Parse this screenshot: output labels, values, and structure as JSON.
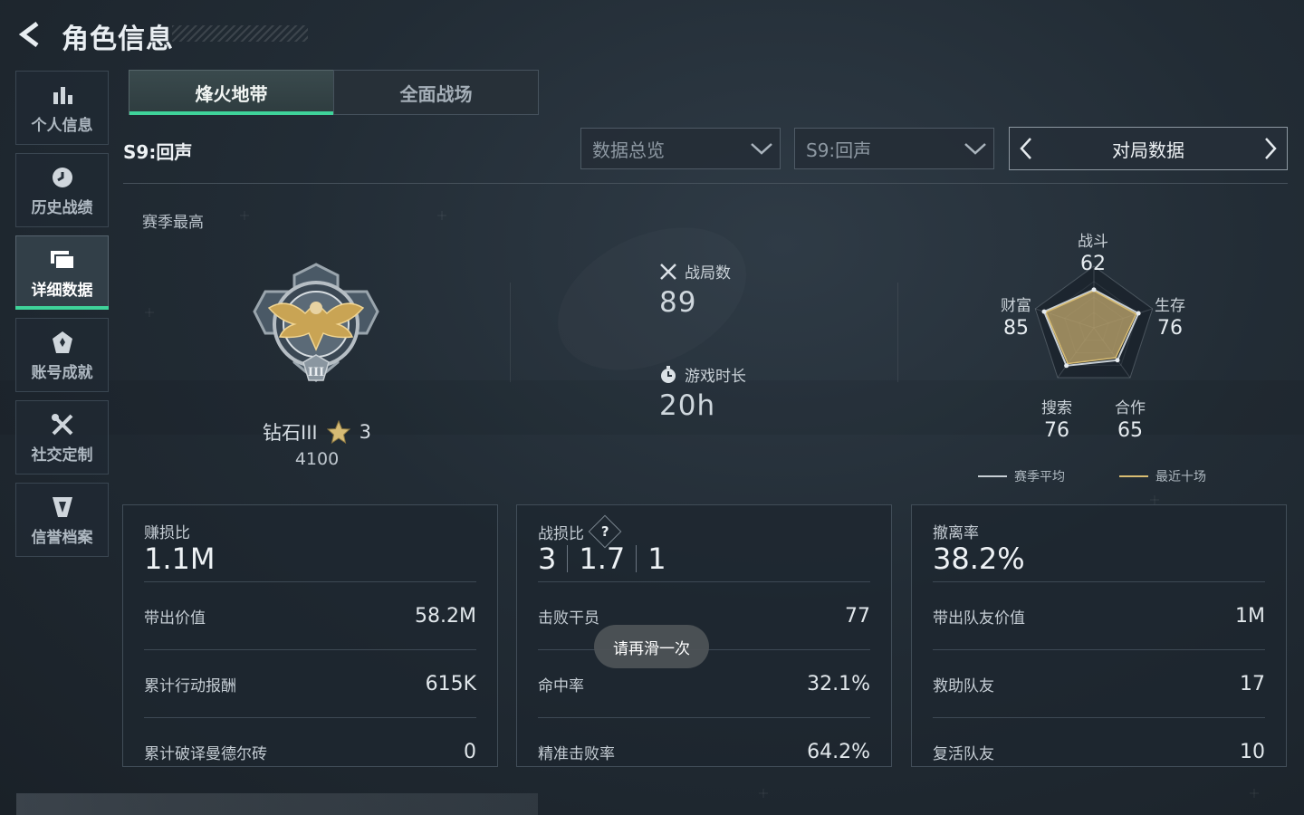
{
  "header": {
    "title": "角色信息"
  },
  "sidebar": {
    "items": [
      {
        "label": "个人信息",
        "icon": "bar-chart-icon"
      },
      {
        "label": "历史战绩",
        "icon": "clock-icon"
      },
      {
        "label": "详细数据",
        "icon": "cards-icon",
        "active": true
      },
      {
        "label": "账号成就",
        "icon": "achievement-icon"
      },
      {
        "label": "社交定制",
        "icon": "tools-icon"
      },
      {
        "label": "信誉档案",
        "icon": "shield-badge-icon"
      }
    ]
  },
  "tabs": [
    {
      "label": "烽火地带",
      "active": true
    },
    {
      "label": "全面战场",
      "active": false
    }
  ],
  "season_label": "S9:回声",
  "filters": {
    "overview": "数据总览",
    "season": "S9:回声",
    "match_switch": "对局数据"
  },
  "season_best": {
    "label": "赛季最高",
    "rank_name": "钻石III",
    "stars": "3",
    "score": "4100"
  },
  "stats": {
    "matches_label": "战局数",
    "matches_value": "89",
    "playtime_label": "游戏时长",
    "playtime_value": "20h"
  },
  "radar": {
    "axes": [
      {
        "label": "战斗",
        "value": "62"
      },
      {
        "label": "生存",
        "value": "76"
      },
      {
        "label": "合作",
        "value": "65"
      },
      {
        "label": "搜索",
        "value": "76"
      },
      {
        "label": "财富",
        "value": "85"
      }
    ],
    "season_avg": [
      62,
      76,
      65,
      76,
      85
    ],
    "recent_ten": [
      60,
      72,
      60,
      72,
      82
    ],
    "legend_season_avg": "赛季平均",
    "legend_recent": "最近十场",
    "colors": {
      "fill": "#b8a069",
      "season_line": "#c7ced4",
      "recent_line": "#d9bd72"
    }
  },
  "panels": {
    "profit": {
      "title": "赚损比",
      "value": "1.1M",
      "rows": [
        {
          "label": "带出价值",
          "value": "58.2M"
        },
        {
          "label": "累计行动报酬",
          "value": "615K"
        },
        {
          "label": "累计破译曼德尔砖",
          "value": "0"
        }
      ]
    },
    "kd": {
      "title": "战损比",
      "help": "?",
      "v1": "3",
      "v2": "1.7",
      "v3": "1",
      "rows": [
        {
          "label": "击败干员",
          "value": "77"
        },
        {
          "label": "命中率",
          "value": "32.1%"
        },
        {
          "label": "精准击败率",
          "value": "64.2%"
        }
      ]
    },
    "extract": {
      "title": "撤离率",
      "value": "38.2%",
      "rows": [
        {
          "label": "带出队友价值",
          "value": "1M"
        },
        {
          "label": "救助队友",
          "value": "17"
        },
        {
          "label": "复活队友",
          "value": "10"
        }
      ]
    }
  },
  "toast": "请再滑一次",
  "accent": "#3fd39a"
}
